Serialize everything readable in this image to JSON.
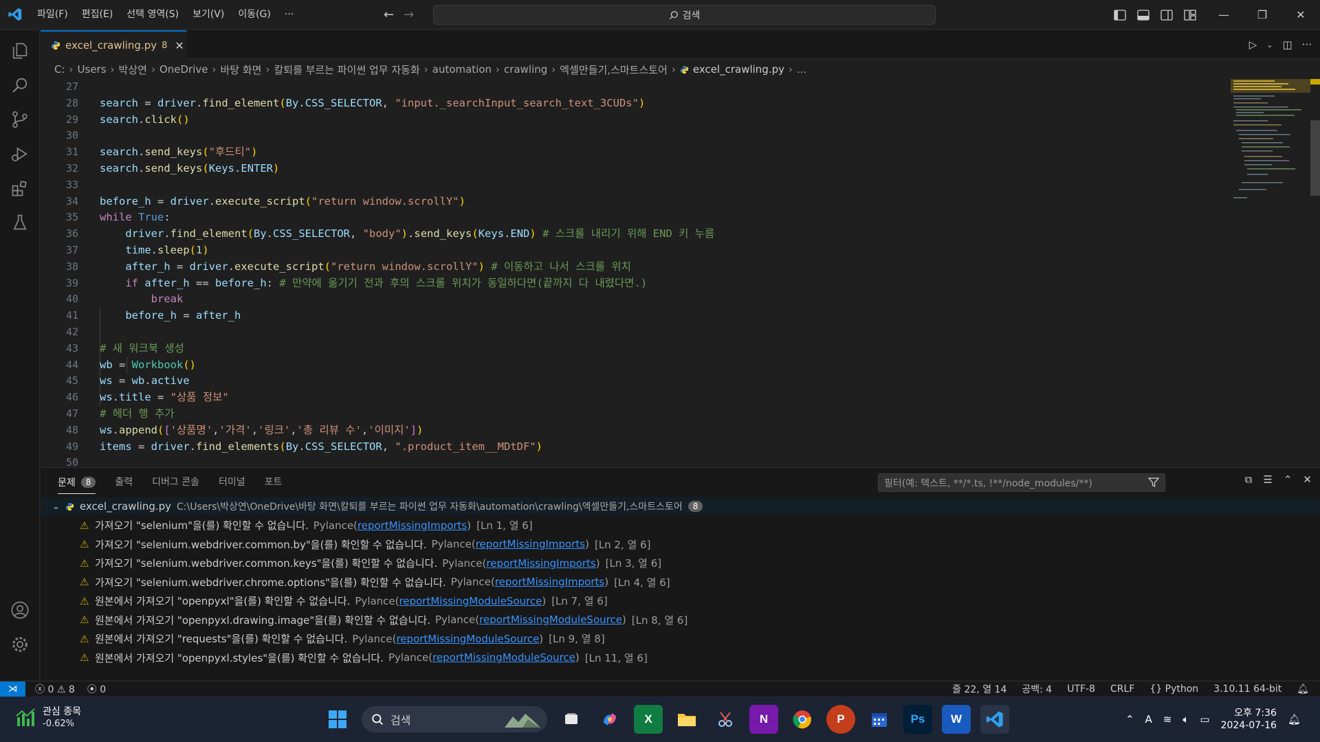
{
  "menu": [
    "파일(F)",
    "편집(E)",
    "선택 영역(S)",
    "보기(V)",
    "이동(G)",
    "···"
  ],
  "search_label": "검색",
  "tab": {
    "file": "excel_crawling.py",
    "count": "8"
  },
  "breadcrumb": [
    "C:",
    "Users",
    "박상연",
    "OneDrive",
    "바탕 화면",
    "칼퇴를 부르는 파이썬 업무 자동화",
    "automation",
    "crawling",
    "엑셀만들기,스마트스토어",
    "excel_crawling.py",
    "..."
  ],
  "line_numbers": [
    "27",
    "28",
    "29",
    "30",
    "31",
    "32",
    "33",
    "34",
    "35",
    "36",
    "37",
    "38",
    "39",
    "40",
    "41",
    "42",
    "43",
    "44",
    "45",
    "46",
    "47",
    "48",
    "49",
    "50"
  ],
  "code_lines": [
    "",
    "search = driver.find_element(By.CSS_SELECTOR, \"input._searchInput_search_text_3CUDs\")",
    "search.click()",
    "",
    "search.send_keys(\"후드티\")",
    "search.send_keys(Keys.ENTER)",
    "",
    "before_h = driver.execute_script(\"return window.scrollY\")",
    "while True:",
    "    driver.find_element(By.CSS_SELECTOR, \"body\").send_keys(Keys.END) # 스크롤 내리기 위해 END 키 누름",
    "    time.sleep(1)",
    "    after_h = driver.execute_script(\"return window.scrollY\") # 이동하고 나서 스크롤 위치",
    "    if after_h == before_h: # 만약에 옮기기 전과 후의 스크롤 위치가 동일하다면(끝까지 다 내렸다면.)",
    "        break",
    "    before_h = after_h",
    "",
    "# 새 워크북 생성",
    "wb = Workbook()",
    "ws = wb.active",
    "ws.title = \"상품 정보\"",
    "# 헤더 행 추가",
    "ws.append(['상품명','가격','링크','총 리뷰 수','이미지'])",
    "items = driver.find_elements(By.CSS_SELECTOR, \".product_item__MDtDF\")",
    ""
  ],
  "panel": {
    "tabs": [
      "문제",
      "출력",
      "디버그 콘솔",
      "터미널",
      "포트"
    ],
    "problem_count": "8",
    "filter_placeholder": "필터(예: 텍스트, **/*.ts, !**/node_modules/**)",
    "group_file": "excel_crawling.py",
    "group_path": "C:\\Users\\박상연\\OneDrive\\바탕 화면\\칼퇴를 부르는 파이썬 업무 자동화\\automation\\crawling\\엑셀만들기,스마트스토어",
    "group_count": "8",
    "problems": [
      {
        "msg": "가져오기 \"selenium\"을(를) 확인할 수 없습니다.",
        "src": "Pylance(",
        "code": "reportMissingImports",
        "end": ")",
        "loc": "[Ln 1, 열 6]"
      },
      {
        "msg": "가져오기 \"selenium.webdriver.common.by\"을(를) 확인할 수 없습니다.",
        "src": "Pylance(",
        "code": "reportMissingImports",
        "end": ")",
        "loc": "[Ln 2, 열 6]"
      },
      {
        "msg": "가져오기 \"selenium.webdriver.common.keys\"을(를) 확인할 수 없습니다.",
        "src": "Pylance(",
        "code": "reportMissingImports",
        "end": ")",
        "loc": "[Ln 3, 열 6]"
      },
      {
        "msg": "가져오기 \"selenium.webdriver.chrome.options\"을(를) 확인할 수 없습니다.",
        "src": "Pylance(",
        "code": "reportMissingImports",
        "end": ")",
        "loc": "[Ln 4, 열 6]"
      },
      {
        "msg": "원본에서 가져오기 \"openpyxl\"을(를) 확인할 수 없습니다.",
        "src": "Pylance(",
        "code": "reportMissingModuleSource",
        "end": ")",
        "loc": "[Ln 7, 열 6]"
      },
      {
        "msg": "원본에서 가져오기 \"openpyxl.drawing.image\"을(를) 확인할 수 없습니다.",
        "src": "Pylance(",
        "code": "reportMissingModuleSource",
        "end": ")",
        "loc": "[Ln 8, 열 6]"
      },
      {
        "msg": "원본에서 가져오기 \"requests\"을(를) 확인할 수 없습니다.",
        "src": "Pylance(",
        "code": "reportMissingModuleSource",
        "end": ")",
        "loc": "[Ln 9, 열 8]"
      },
      {
        "msg": "원본에서 가져오기 \"openpyxl.styles\"을(를) 확인할 수 없습니다.",
        "src": "Pylance(",
        "code": "reportMissingModuleSource",
        "end": ")",
        "loc": "[Ln 11, 열 6]"
      }
    ]
  },
  "status": {
    "errors": "0",
    "warnings": "8",
    "ports": "0",
    "position": "줄 22, 열 14",
    "spaces": "공백: 4",
    "encoding": "UTF-8",
    "eol": "CRLF",
    "language": "Python",
    "interpreter": "3.10.11 64-bit"
  },
  "taskbar": {
    "widget_title": "관심 종목",
    "widget_change": "-0.62%",
    "search_label": "검색",
    "time": "오후 7:36",
    "date": "2024-07-16"
  },
  "colors": {
    "accent": "#0078d4",
    "warning": "#cca700",
    "link": "#3794ff"
  }
}
